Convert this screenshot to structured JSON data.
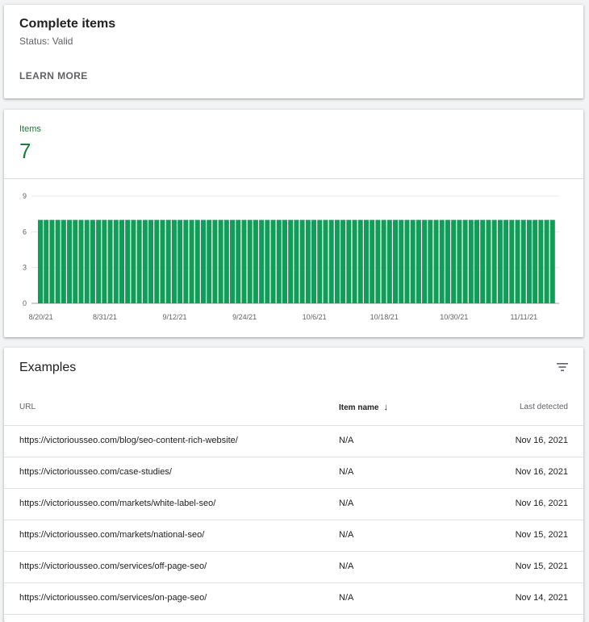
{
  "status_card": {
    "title": "Complete items",
    "subtitle": "Status: Valid",
    "learn_more": "LEARN MORE"
  },
  "items_card": {
    "label": "Items",
    "value": "7",
    "accent_color": "#188038",
    "bar_color": "#0f9d58"
  },
  "chart_data": {
    "type": "bar",
    "title": "",
    "xlabel": "",
    "ylabel": "",
    "ylim": [
      0,
      9
    ],
    "yticks": [
      "0",
      "3",
      "6",
      "9"
    ],
    "grid": true,
    "x_tick_labels": [
      "8/20/21",
      "8/31/21",
      "9/12/21",
      "9/24/21",
      "10/6/21",
      "10/18/21",
      "10/30/21",
      "11/11/21"
    ],
    "start_date": "8/20/21",
    "end_date": "11/16/21",
    "bar_count": 89,
    "values": [
      7,
      7,
      7,
      7,
      7,
      7,
      7,
      7,
      7,
      7,
      7,
      7,
      7,
      7,
      7,
      7,
      7,
      7,
      7,
      7,
      7,
      7,
      7,
      7,
      7,
      7,
      7,
      7,
      7,
      7,
      7,
      7,
      7,
      7,
      7,
      7,
      7,
      7,
      7,
      7,
      7,
      7,
      7,
      7,
      7,
      7,
      7,
      7,
      7,
      7,
      7,
      7,
      7,
      7,
      7,
      7,
      7,
      7,
      7,
      7,
      7,
      7,
      7,
      7,
      7,
      7,
      7,
      7,
      7,
      7,
      7,
      7,
      7,
      7,
      7,
      7,
      7,
      7,
      7,
      7,
      7,
      7,
      7,
      7,
      7,
      7,
      7,
      7,
      7
    ]
  },
  "examples": {
    "title": "Examples",
    "filter_icon": "filter-icon",
    "columns": {
      "url": "URL",
      "item_name": "Item name",
      "last_detected": "Last detected"
    },
    "sort_icon": "arrow-down-icon",
    "rows": [
      {
        "url": "https://victoriousseo.com/blog/seo-content-rich-website/",
        "item_name": "N/A",
        "last_detected": "Nov 16, 2021"
      },
      {
        "url": "https://victoriousseo.com/case-studies/",
        "item_name": "N/A",
        "last_detected": "Nov 16, 2021"
      },
      {
        "url": "https://victoriousseo.com/markets/white-label-seo/",
        "item_name": "N/A",
        "last_detected": "Nov 16, 2021"
      },
      {
        "url": "https://victoriousseo.com/markets/national-seo/",
        "item_name": "N/A",
        "last_detected": "Nov 15, 2021"
      },
      {
        "url": "https://victoriousseo.com/services/off-page-seo/",
        "item_name": "N/A",
        "last_detected": "Nov 15, 2021"
      },
      {
        "url": "https://victoriousseo.com/services/on-page-seo/",
        "item_name": "N/A",
        "last_detected": "Nov 14, 2021"
      }
    ]
  }
}
